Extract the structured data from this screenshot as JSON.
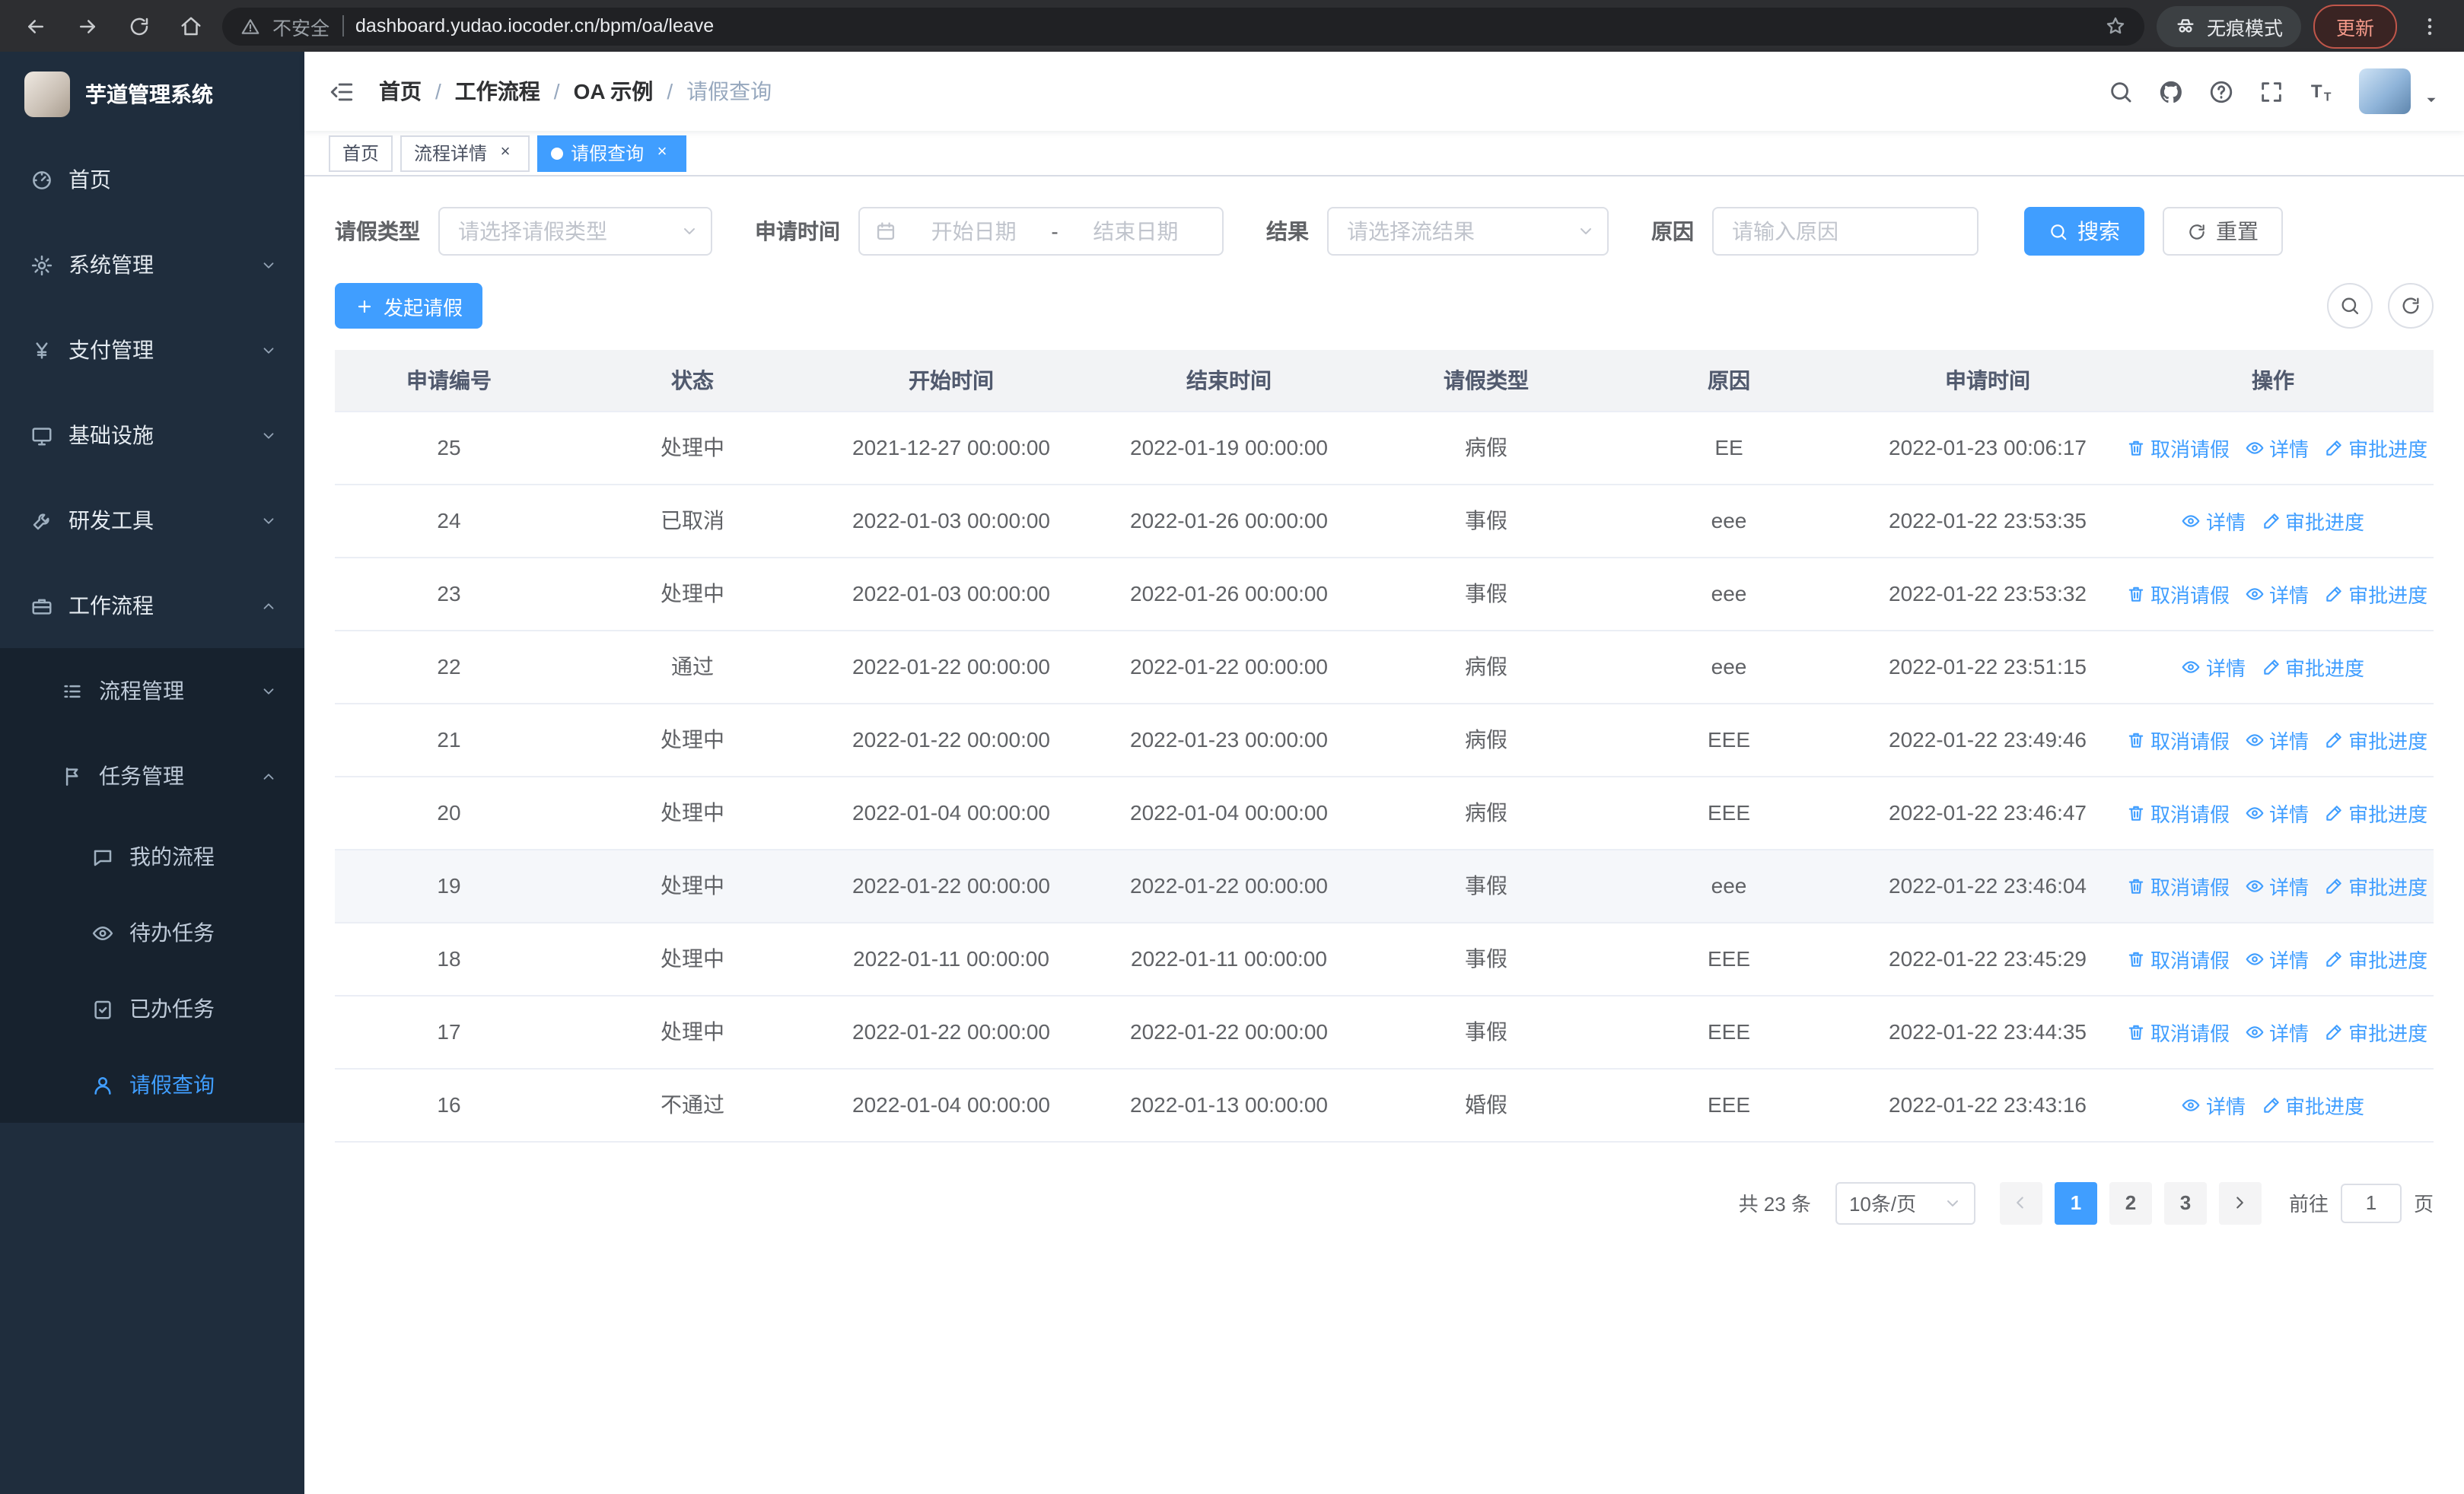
{
  "browser": {
    "security_label": "不安全",
    "url": "dashboard.yudao.iocoder.cn/bpm/oa/leave",
    "incognito_label": "无痕模式",
    "update_label": "更新"
  },
  "sidebar": {
    "title": "芋道管理系统",
    "items": [
      {
        "key": "home",
        "label": "首页",
        "icon": "gauge",
        "level": 0
      },
      {
        "key": "system",
        "label": "系统管理",
        "icon": "gear",
        "level": 0,
        "caret": "down"
      },
      {
        "key": "payment",
        "label": "支付管理",
        "icon": "yen",
        "level": 0,
        "caret": "down"
      },
      {
        "key": "infra",
        "label": "基础设施",
        "icon": "monitor",
        "level": 0,
        "caret": "down"
      },
      {
        "key": "devtools",
        "label": "研发工具",
        "icon": "tools",
        "level": 0,
        "caret": "down"
      },
      {
        "key": "workflow",
        "label": "工作流程",
        "icon": "briefcase",
        "level": 0,
        "caret": "up"
      },
      {
        "key": "process-mgmt",
        "label": "流程管理",
        "icon": "flow",
        "level": 1,
        "caret": "down"
      },
      {
        "key": "task-mgmt",
        "label": "任务管理",
        "icon": "tasks",
        "level": 1,
        "caret": "up"
      },
      {
        "key": "my-process",
        "label": "我的流程",
        "icon": "chat",
        "level": 2
      },
      {
        "key": "todo-tasks",
        "label": "待办任务",
        "icon": "eye",
        "level": 2
      },
      {
        "key": "done-tasks",
        "label": "已办任务",
        "icon": "done",
        "level": 2
      },
      {
        "key": "leave-query",
        "label": "请假查询",
        "icon": "user",
        "level": 2,
        "active": true
      }
    ]
  },
  "header": {
    "breadcrumb": [
      "首页",
      "工作流程",
      "OA 示例",
      "请假查询"
    ]
  },
  "tabs": [
    {
      "key": "home",
      "label": "首页",
      "closable": false,
      "active": false
    },
    {
      "key": "process-detail",
      "label": "流程详情",
      "closable": true,
      "active": false
    },
    {
      "key": "leave-query",
      "label": "请假查询",
      "closable": true,
      "active": true
    }
  ],
  "filters": {
    "leave_type_label": "请假类型",
    "leave_type_placeholder": "请选择请假类型",
    "apply_time_label": "申请时间",
    "start_date_placeholder": "开始日期",
    "range_separator": "-",
    "end_date_placeholder": "结束日期",
    "result_label": "结果",
    "result_placeholder": "请选择流结果",
    "reason_label": "原因",
    "reason_placeholder": "请输入原因",
    "search_label": "搜索",
    "reset_label": "重置"
  },
  "toolbar": {
    "create_label": "发起请假"
  },
  "table": {
    "columns": [
      "申请编号",
      "状态",
      "开始时间",
      "结束时间",
      "请假类型",
      "原因",
      "申请时间",
      "操作"
    ],
    "action_labels": {
      "cancel": "取消请假",
      "detail": "详情",
      "progress": "审批进度"
    },
    "rows": [
      {
        "id": "25",
        "status": "处理中",
        "start": "2021-12-27 00:00:00",
        "end": "2022-01-19 00:00:00",
        "type": "病假",
        "reason": "EE",
        "applied": "2022-01-23 00:06:17",
        "actions": [
          "cancel",
          "detail",
          "progress"
        ]
      },
      {
        "id": "24",
        "status": "已取消",
        "start": "2022-01-03 00:00:00",
        "end": "2022-01-26 00:00:00",
        "type": "事假",
        "reason": "eee",
        "applied": "2022-01-22 23:53:35",
        "actions": [
          "detail",
          "progress"
        ]
      },
      {
        "id": "23",
        "status": "处理中",
        "start": "2022-01-03 00:00:00",
        "end": "2022-01-26 00:00:00",
        "type": "事假",
        "reason": "eee",
        "applied": "2022-01-22 23:53:32",
        "actions": [
          "cancel",
          "detail",
          "progress"
        ]
      },
      {
        "id": "22",
        "status": "通过",
        "start": "2022-01-22 00:00:00",
        "end": "2022-01-22 00:00:00",
        "type": "病假",
        "reason": "eee",
        "applied": "2022-01-22 23:51:15",
        "actions": [
          "detail",
          "progress"
        ]
      },
      {
        "id": "21",
        "status": "处理中",
        "start": "2022-01-22 00:00:00",
        "end": "2022-01-23 00:00:00",
        "type": "病假",
        "reason": "EEE",
        "applied": "2022-01-22 23:49:46",
        "actions": [
          "cancel",
          "detail",
          "progress"
        ]
      },
      {
        "id": "20",
        "status": "处理中",
        "start": "2022-01-04 00:00:00",
        "end": "2022-01-04 00:00:00",
        "type": "病假",
        "reason": "EEE",
        "applied": "2022-01-22 23:46:47",
        "actions": [
          "cancel",
          "detail",
          "progress"
        ]
      },
      {
        "id": "19",
        "status": "处理中",
        "start": "2022-01-22 00:00:00",
        "end": "2022-01-22 00:00:00",
        "type": "事假",
        "reason": "eee",
        "applied": "2022-01-22 23:46:04",
        "actions": [
          "cancel",
          "detail",
          "progress"
        ],
        "hover": true
      },
      {
        "id": "18",
        "status": "处理中",
        "start": "2022-01-11 00:00:00",
        "end": "2022-01-11 00:00:00",
        "type": "事假",
        "reason": "EEE",
        "applied": "2022-01-22 23:45:29",
        "actions": [
          "cancel",
          "detail",
          "progress"
        ]
      },
      {
        "id": "17",
        "status": "处理中",
        "start": "2022-01-22 00:00:00",
        "end": "2022-01-22 00:00:00",
        "type": "事假",
        "reason": "EEE",
        "applied": "2022-01-22 23:44:35",
        "actions": [
          "cancel",
          "detail",
          "progress"
        ]
      },
      {
        "id": "16",
        "status": "不通过",
        "start": "2022-01-04 00:00:00",
        "end": "2022-01-13 00:00:00",
        "type": "婚假",
        "reason": "EEE",
        "applied": "2022-01-22 23:43:16",
        "actions": [
          "detail",
          "progress"
        ]
      }
    ]
  },
  "pagination": {
    "total_label": "共 23 条",
    "page_size": "10条/页",
    "pages": [
      "1",
      "2",
      "3"
    ],
    "active_page": "1",
    "goto_label": "前往",
    "goto_value": "1",
    "goto_suffix": "页"
  },
  "colors": {
    "primary": "#409eff",
    "sidebar_bg": "#1f2d3d",
    "sidebar_submenu_bg": "#17222e",
    "table_header_bg": "#f2f3f5",
    "hover_row_bg": "#f5f7fa",
    "update_chip_text": "#f59a8a"
  }
}
